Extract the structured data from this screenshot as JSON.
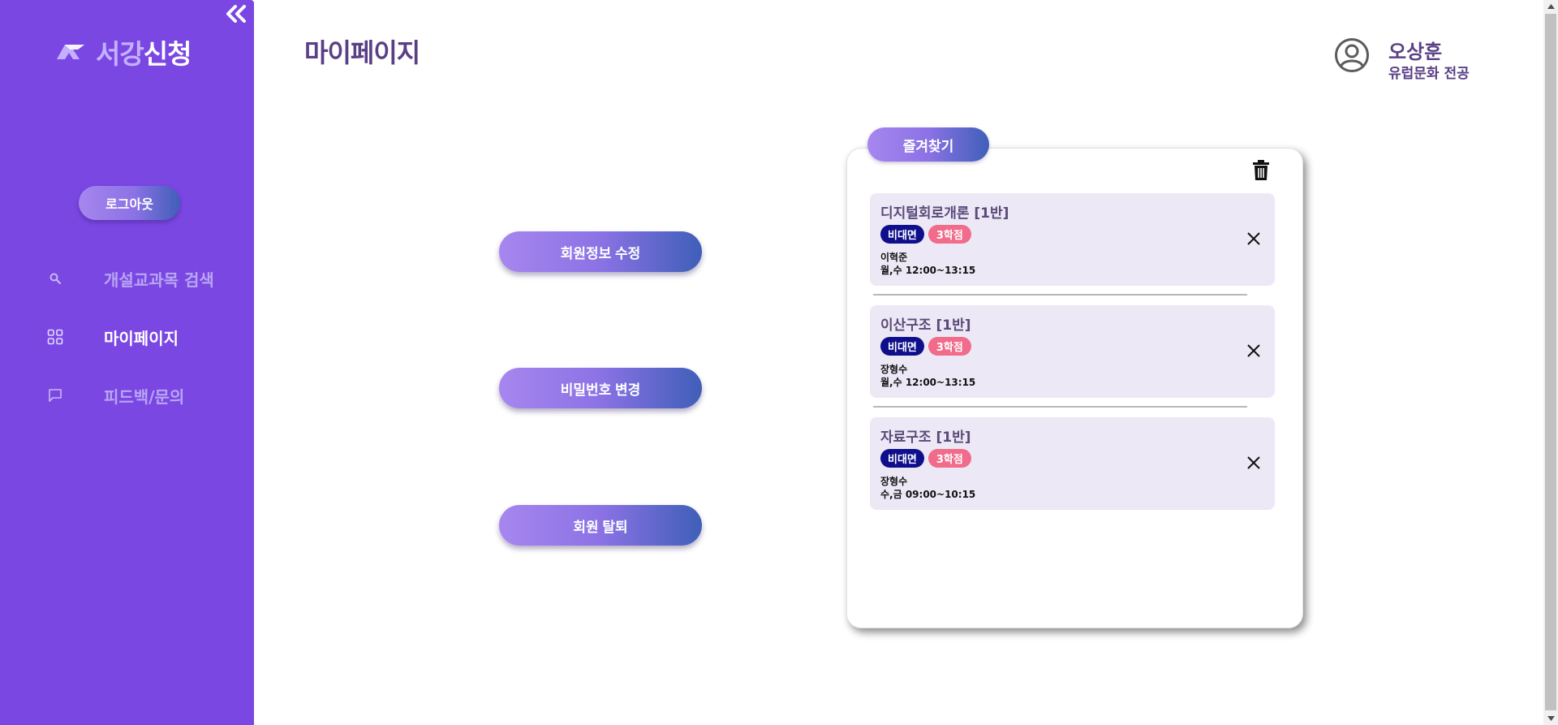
{
  "sidebar": {
    "logo_text_a": "서강",
    "logo_text_b": "신청",
    "logout_label": "로그아웃",
    "items": [
      {
        "label": "개설교과목 검색",
        "icon": "search-icon",
        "active": false
      },
      {
        "label": "마이페이지",
        "icon": "grid-icon",
        "active": true
      },
      {
        "label": "피드백/문의",
        "icon": "chat-icon",
        "active": false
      }
    ]
  },
  "header": {
    "title": "마이페이지",
    "user_name": "오상훈",
    "user_major": "유럽문화 전공"
  },
  "actions": {
    "edit_profile": "회원정보 수정",
    "change_password": "비밀번호 변경",
    "withdraw": "회원 탈퇴"
  },
  "favorites": {
    "tab_label": "즐겨찾기",
    "courses": [
      {
        "title": "디지털회로개론 [1반]",
        "mode": "비대면",
        "credit": "3학점",
        "professor": "이혁준",
        "time": "월,수 12:00~13:15"
      },
      {
        "title": "이산구조 [1반]",
        "mode": "비대면",
        "credit": "3학점",
        "professor": "장형수",
        "time": "월,수 12:00~13:15"
      },
      {
        "title": "자료구조 [1반]",
        "mode": "비대면",
        "credit": "3학점",
        "professor": "장형수",
        "time": "수,금 09:00~10:15"
      }
    ]
  },
  "colors": {
    "sidebar_bg": "#7a47e3",
    "title_text": "#5a3f86",
    "badge_mode": "#0f0f8c",
    "badge_credit": "#f16b8a",
    "course_bg": "#ece8f6"
  }
}
